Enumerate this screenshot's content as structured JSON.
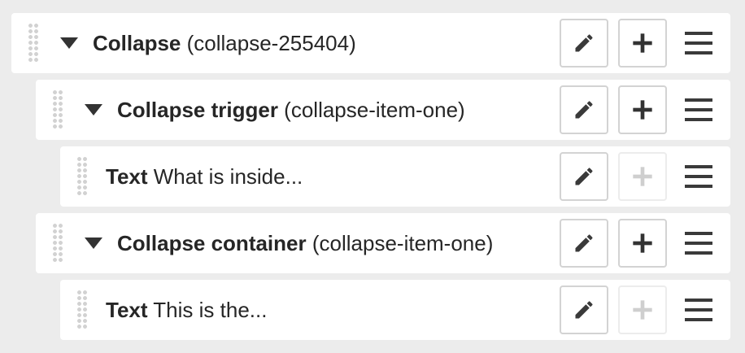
{
  "tree": {
    "rows": [
      {
        "name": "Collapse",
        "detail": "(collapse-255404)",
        "expandable": true,
        "add_enabled": true
      },
      {
        "name": "Collapse trigger",
        "detail": "(collapse-item-one)",
        "expandable": true,
        "add_enabled": true
      },
      {
        "name": "Text",
        "detail": "What is inside...",
        "expandable": false,
        "add_enabled": false
      },
      {
        "name": "Collapse container",
        "detail": "(collapse-item-one)",
        "expandable": true,
        "add_enabled": true
      },
      {
        "name": "Text",
        "detail": "This is the...",
        "expandable": false,
        "add_enabled": false
      }
    ]
  },
  "icons": {
    "drag_handle": "drag-handle-icon",
    "caret": "caret-down-icon",
    "edit": "pencil-icon",
    "add": "plus-icon",
    "menu": "hamburger-menu-icon"
  },
  "colors": {
    "background": "#ececec",
    "row_background": "#ffffff",
    "icon_dark": "#3a3a3a",
    "icon_disabled": "#cfcfcf",
    "button_border": "#d3d3d3"
  }
}
